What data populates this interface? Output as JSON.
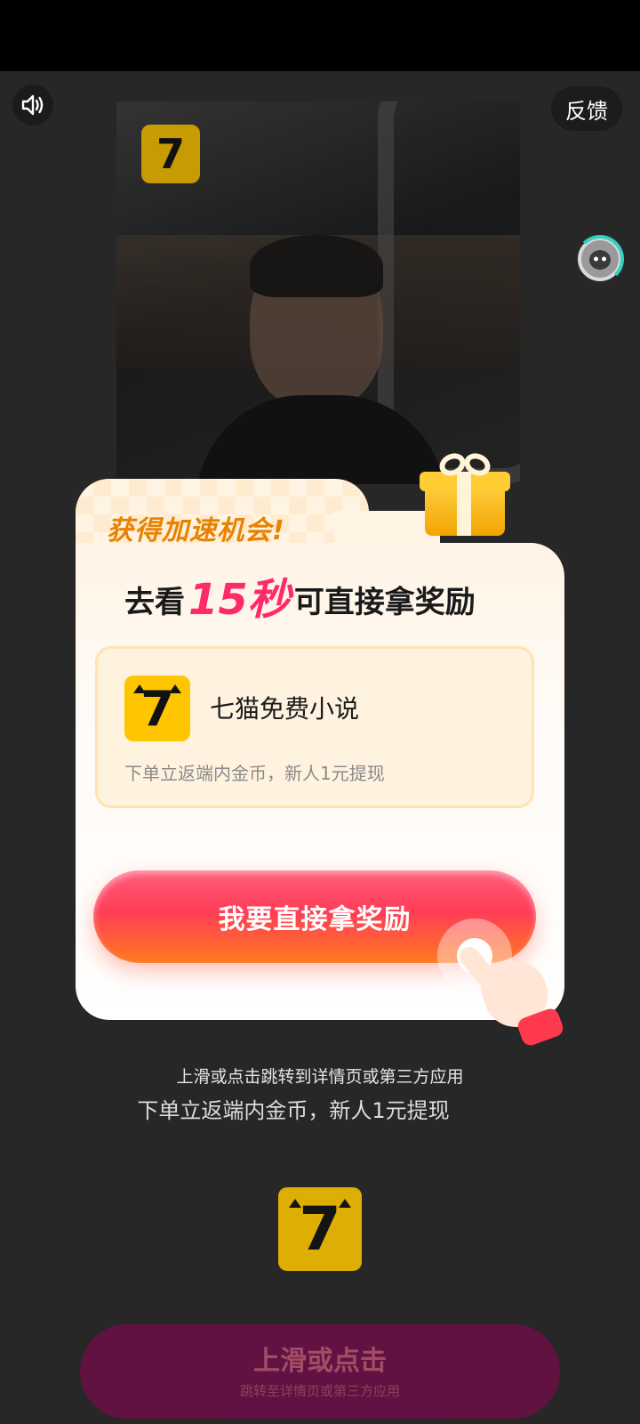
{
  "top_controls": {
    "sound_icon": "speaker-icon",
    "feedback_label": "反馈"
  },
  "popup": {
    "tab_title": "获得加速机会!",
    "headline_prefix": "去看",
    "headline_highlight": "15秒",
    "headline_suffix": "可直接拿奖励",
    "app_name": "七猫免费小说",
    "app_desc": "下单立返端内金币，新人1元提现",
    "cta_label": "我要直接拿奖励"
  },
  "ad_info": {
    "hint": "上滑或点击跳转到详情页或第三方应用",
    "desc": "下单立返端内金币，新人1元提现"
  },
  "bottom_cta": {
    "title": "上滑或点击",
    "subtitle": "跳转至详情页或第三方应用"
  },
  "colors": {
    "accent_pink": "#ff3d57",
    "accent_orange": "#ff7a1f",
    "tab_title": "#e98200",
    "logo_yellow": "#ffc600"
  }
}
